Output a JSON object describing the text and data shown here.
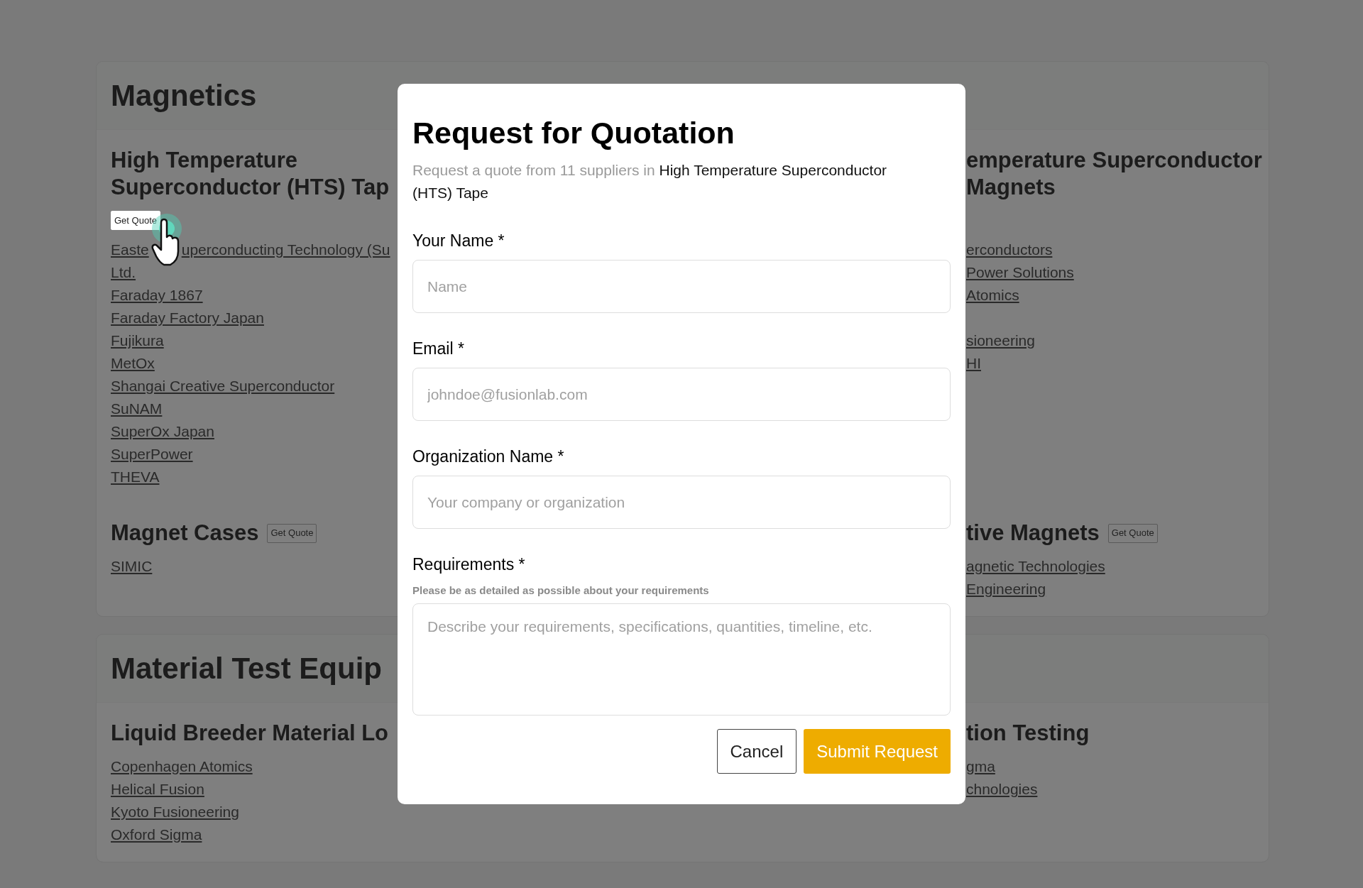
{
  "sections": [
    {
      "title": "Magnetics",
      "groups": [
        {
          "left": {
            "heading_lines": [
              "High Temperature",
              "Superconductor (HTS) Tap"
            ],
            "quote_button": {
              "label": "Get Quote",
              "kind": "below",
              "highlighted": true
            },
            "links": [
              {
                "parts": [
                  "Easte",
                  "uperconducting Technology (Su"
                ]
              },
              {
                "parts": [
                  "Ltd."
                ]
              },
              {
                "parts": [
                  "Faraday 1867"
                ]
              },
              {
                "parts": [
                  "Faraday Factory Japan"
                ]
              },
              {
                "parts": [
                  "Fujikura"
                ]
              },
              {
                "parts": [
                  "MetOx"
                ]
              },
              {
                "parts": [
                  "Shangai Creative Superconductor"
                ]
              },
              {
                "parts": [
                  "SuNAM"
                ]
              },
              {
                "parts": [
                  "SuperOx Japan"
                ]
              },
              {
                "parts": [
                  "SuperPower"
                ]
              },
              {
                "parts": [
                  "THEVA"
                ]
              }
            ]
          },
          "right": {
            "heading_lines": [
              "emperature Superconductor",
              "Magnets"
            ],
            "links": [
              {
                "text": "erconductors",
                "gap_before": false
              },
              {
                "text": "Power Solutions",
                "gap_before": false
              },
              {
                "text": "Atomics",
                "gap_before": false
              },
              {
                "text": "sioneering",
                "gap_before": true
              },
              {
                "text": "HI",
                "gap_before": false
              }
            ]
          }
        },
        {
          "left": {
            "heading_lines": [
              "Magnet Cases"
            ],
            "quote_button": {
              "label": "Get Quote",
              "kind": "inline",
              "highlighted": false
            },
            "links": [
              {
                "parts": [
                  "SIMIC"
                ]
              }
            ]
          },
          "right": {
            "heading_lines": [
              "tive Magnets"
            ],
            "quote_button": {
              "label": "Get Quote",
              "kind": "inline",
              "highlighted": false
            },
            "links": [
              {
                "text": "agnetic Technologies",
                "gap_before": false
              },
              {
                "text": "Engineering",
                "gap_before": false
              }
            ]
          }
        }
      ]
    },
    {
      "title": "Material Test Equip",
      "groups": [
        {
          "left": {
            "heading_lines": [
              "Liquid Breeder Material Lo"
            ],
            "links": [
              {
                "parts": [
                  "Copenhagen Atomics"
                ]
              },
              {
                "parts": [
                  "Helical Fusion"
                ]
              },
              {
                "parts": [
                  "Kyoto Fusioneering"
                ]
              },
              {
                "parts": [
                  "Oxford Sigma"
                ]
              }
            ]
          },
          "right": {
            "heading_lines": [
              "tion Testing"
            ],
            "links": [
              {
                "text": "gma",
                "gap_before": false
              },
              {
                "text": "chnologies",
                "gap_before": false
              }
            ]
          }
        }
      ]
    }
  ],
  "modal": {
    "title": "Request for Quotation",
    "description": "Request a quote from 11 suppliers in",
    "category": "High Temperature Superconductor (HTS) Tape",
    "fields": [
      {
        "label": "Your Name *",
        "placeholder": "Name",
        "kind": "input"
      },
      {
        "label": "Email *",
        "placeholder": "johndoe@fusionlab.com",
        "kind": "input"
      },
      {
        "label": "Organization Name *",
        "placeholder": "Your company or organization",
        "kind": "input"
      },
      {
        "label": "Requirements *",
        "hint": "Please be as detailed as possible about your requirements",
        "placeholder": "Describe your requirements, specifications, quantities, timeline, etc.",
        "kind": "textarea"
      }
    ],
    "buttons": [
      {
        "label": "Cancel",
        "kind": "secondary"
      },
      {
        "label": "Submit Request",
        "kind": "primary"
      }
    ]
  }
}
